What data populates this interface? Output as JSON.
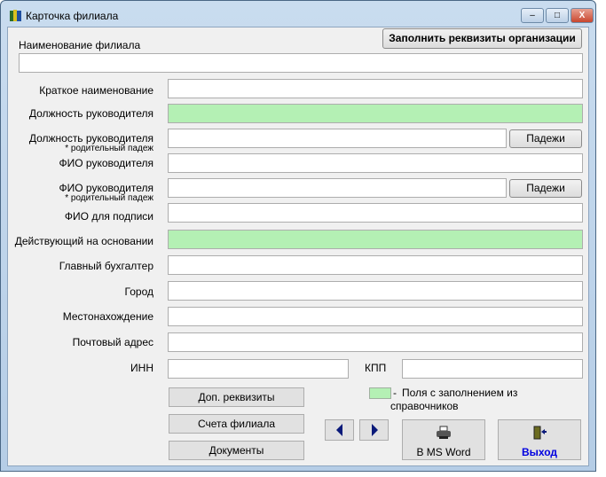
{
  "window": {
    "title": "Карточка филиала",
    "minimize": "–",
    "maximize": "□",
    "close": "X"
  },
  "fill_org_button": "Заполнить реквизиты организации",
  "branch_name_label": "Наименование филиала",
  "fields": {
    "short_name": "Краткое наименование",
    "head_position": "Должность руководителя",
    "head_position_gen": "Должность руководителя",
    "head_position_gen_note": "* родительный падеж",
    "head_name": "ФИО руководителя",
    "head_name_gen": "ФИО руководителя",
    "head_name_gen_note": "* родительный падеж",
    "signature_name": "ФИО для подписи",
    "acting_basis": "Действующий на основании",
    "chief_accountant": "Главный бухгалтер",
    "city": "Город",
    "location": "Местонахождение",
    "postal_address": "Почтовый адрес",
    "inn": "ИНН",
    "kpp": "КПП"
  },
  "cases_button": "Падежи",
  "buttons": {
    "extra": "Доп. реквизиты",
    "accounts": "Счета филиала",
    "documents": "Документы",
    "word": "В MS Word",
    "exit": "Выход"
  },
  "legend": {
    "dash": "-",
    "text": "Поля с заполнением из справочников",
    "color": "#b4f0b4"
  }
}
